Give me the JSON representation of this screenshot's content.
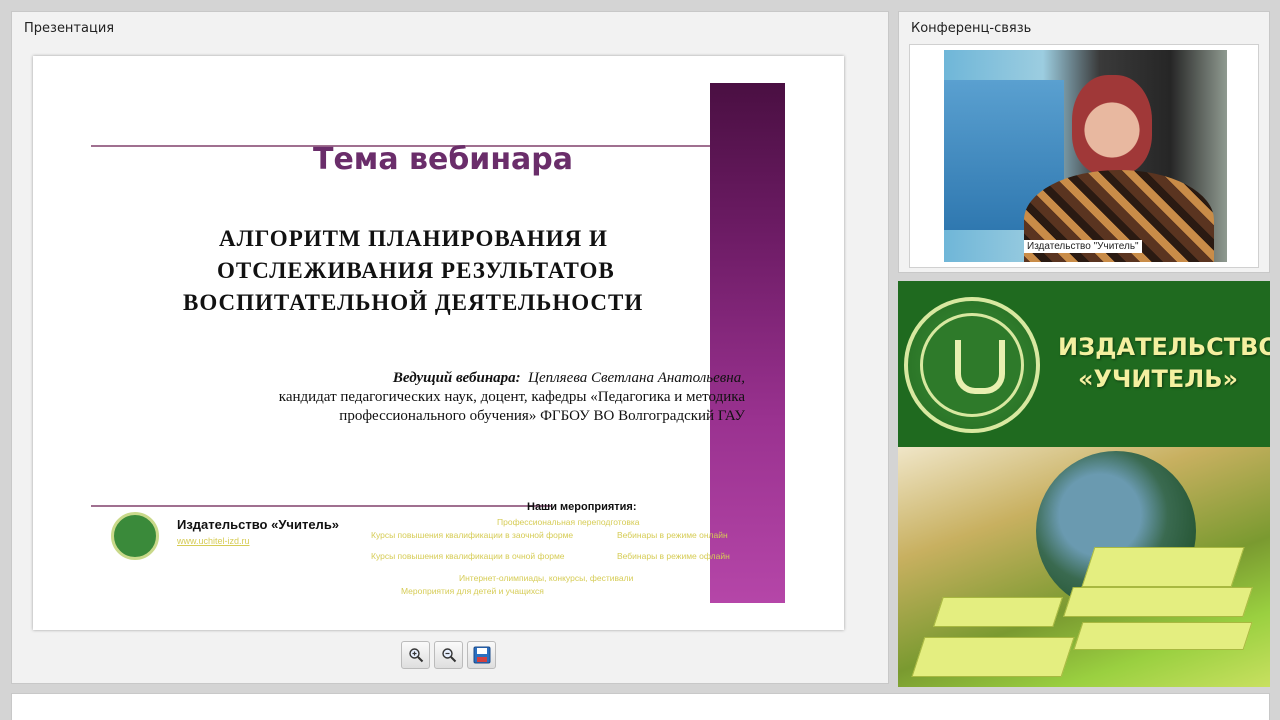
{
  "presentation": {
    "title": "Презентация",
    "slide": {
      "heading": "Тема вебинара",
      "topic_lines": [
        "АЛГОРИТМ ПЛАНИРОВАНИЯ И",
        "ОТСЛЕЖИВАНИЯ РЕЗУЛЬТАТОВ",
        "ВОСПИТАТЕЛЬНОЙ ДЕЯТЕЛЬНОСТИ"
      ],
      "host_label": "Ведущий вебинара:",
      "host_name": "Цепляева Светлана Анатольевна,",
      "host_details_1": "кандидат педагогических наук, доцент, кафедры «Педагогика и методика",
      "host_details_2": "профессионального обучения» ФГБОУ ВО Волгоградский ГАУ",
      "publisher_name": "Издательство «Учитель»",
      "publisher_url": "www.uchitel-izd.ru",
      "events_title": "Наши мероприятия:",
      "event_links": [
        "Профессиональная переподготовка",
        "Курсы повышения квалификации в заочной форме",
        "Вебинары в режиме онлайн",
        "Курсы повышения квалификации в очной форме",
        "Вебинары в режиме офлайн",
        "Интернет-олимпиады, конкурсы, фестивали",
        "Мероприятия для детей и учащихся"
      ]
    },
    "toolbar": {
      "zoom_in_icon": "magnifier-plus-icon",
      "zoom_out_icon": "magnifier-minus-icon",
      "save_icon": "floppy-disk-icon"
    }
  },
  "conference": {
    "title": "Конференц-связь",
    "video_caption": "Издательство \"Учитель\""
  },
  "ad": {
    "line1": "ИЗДАТЕЛЬСТВО",
    "line2": "«УЧИТЕЛЬ»"
  },
  "colors": {
    "slide_heading": "#6a2d6a",
    "purple_bar": "#8a2a80",
    "ad_green": "#1f6a1f",
    "ad_text": "#f4f0a0"
  }
}
